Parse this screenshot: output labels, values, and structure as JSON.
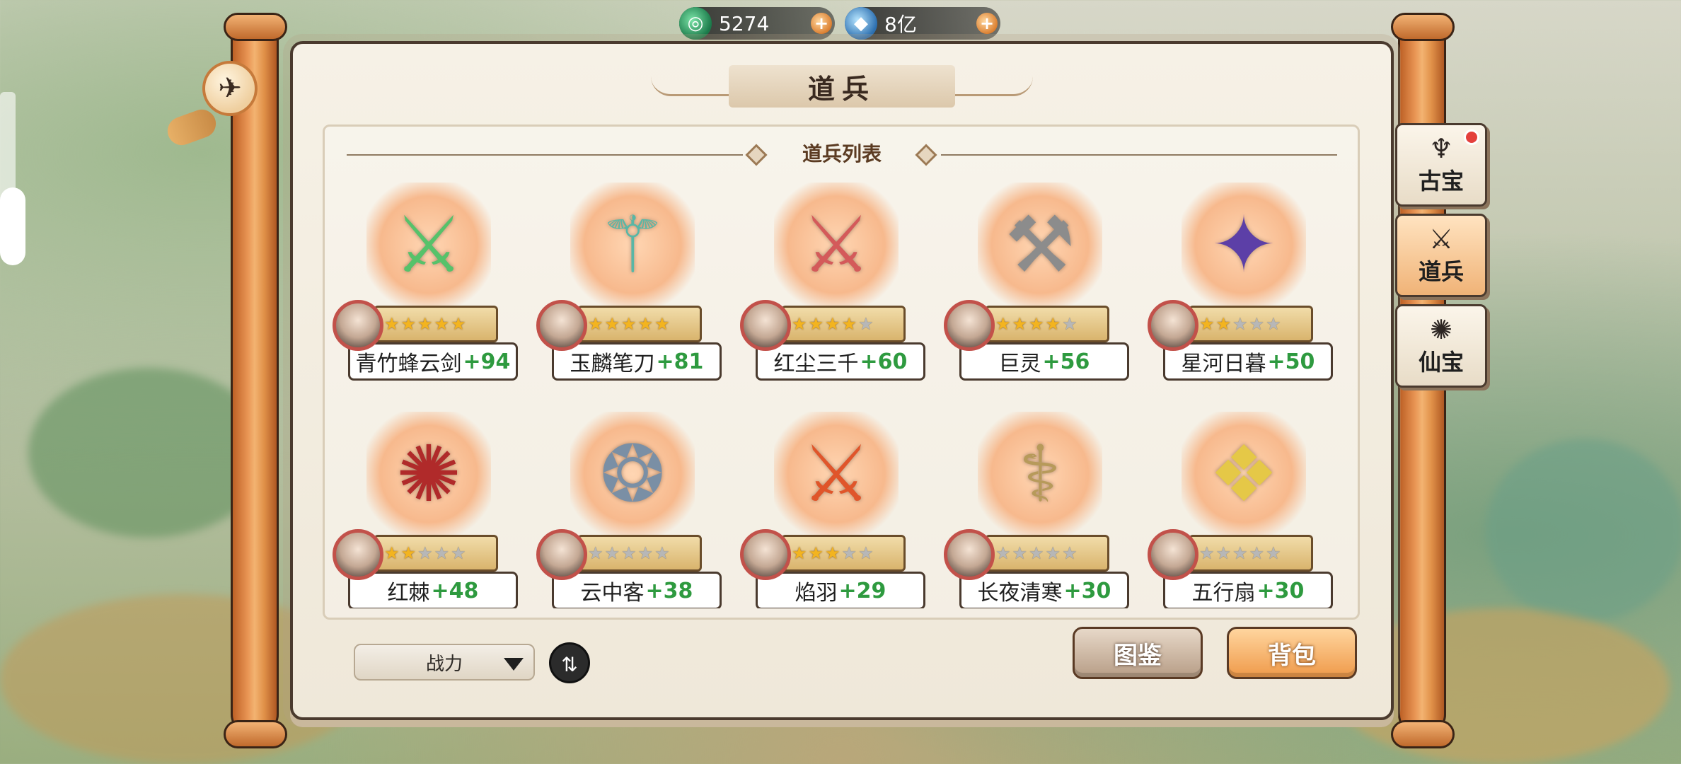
{
  "currency": [
    {
      "icon": "jade-coin-icon",
      "value": "5274"
    },
    {
      "icon": "blue-gem-icon",
      "value": "8亿"
    }
  ],
  "title": "道兵",
  "section_title": "道兵列表",
  "weapons": [
    {
      "name": "青竹蜂云剑",
      "level": "+94",
      "stars": 5,
      "weapon_color": "#56c26a",
      "glyph": "⚔"
    },
    {
      "name": "玉麟笔刀",
      "level": "+81",
      "stars": 5,
      "weapon_color": "#58b7a6",
      "glyph": "⚚"
    },
    {
      "name": "红尘三千",
      "level": "+60",
      "stars": 4,
      "weapon_color": "#d45a5a",
      "glyph": "⚔"
    },
    {
      "name": "巨灵",
      "level": "+56",
      "stars": 4,
      "weapon_color": "#8c8c8c",
      "glyph": "⚒"
    },
    {
      "name": "星河日暮",
      "level": "+50",
      "stars": 2,
      "weapon_color": "#5c3fa7",
      "glyph": "✦"
    },
    {
      "name": "红棘",
      "level": "+48",
      "stars": 2,
      "weapon_color": "#b02a2a",
      "glyph": "✺"
    },
    {
      "name": "云中客",
      "level": "+38",
      "stars": 0,
      "weapon_color": "#7a8fa5",
      "glyph": "❂"
    },
    {
      "name": "焰羽",
      "level": "+29",
      "stars": 3,
      "weapon_color": "#e0552a",
      "glyph": "⚔"
    },
    {
      "name": "长夜清寒",
      "level": "+30",
      "stars": 0,
      "weapon_color": "#b79a5a",
      "glyph": "⚕"
    },
    {
      "name": "五行扇",
      "level": "+30",
      "stars": 0,
      "weapon_color": "#e5c847",
      "glyph": "❖"
    }
  ],
  "controls": {
    "sort_label": "战力",
    "sort_toggle_icon": "swap-icon",
    "codex_button": "图鉴",
    "bag_button": "背包"
  },
  "tabs": [
    {
      "label": "古宝",
      "icon": "ancient-treasure-icon",
      "has_dot": true
    },
    {
      "label": "道兵",
      "icon": "weapon-icon",
      "has_dot": false,
      "active": true
    },
    {
      "label": "仙宝",
      "icon": "immortal-treasure-icon",
      "has_dot": false
    }
  ]
}
